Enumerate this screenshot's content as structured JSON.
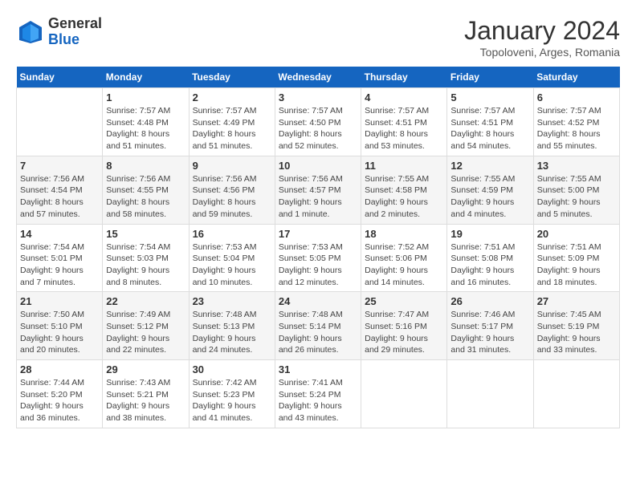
{
  "header": {
    "logo_general": "General",
    "logo_blue": "Blue",
    "month_title": "January 2024",
    "location": "Topoloveni, Arges, Romania"
  },
  "weekdays": [
    "Sunday",
    "Monday",
    "Tuesday",
    "Wednesday",
    "Thursday",
    "Friday",
    "Saturday"
  ],
  "weeks": [
    [
      {
        "day": "",
        "info": ""
      },
      {
        "day": "1",
        "info": "Sunrise: 7:57 AM\nSunset: 4:48 PM\nDaylight: 8 hours\nand 51 minutes."
      },
      {
        "day": "2",
        "info": "Sunrise: 7:57 AM\nSunset: 4:49 PM\nDaylight: 8 hours\nand 51 minutes."
      },
      {
        "day": "3",
        "info": "Sunrise: 7:57 AM\nSunset: 4:50 PM\nDaylight: 8 hours\nand 52 minutes."
      },
      {
        "day": "4",
        "info": "Sunrise: 7:57 AM\nSunset: 4:51 PM\nDaylight: 8 hours\nand 53 minutes."
      },
      {
        "day": "5",
        "info": "Sunrise: 7:57 AM\nSunset: 4:51 PM\nDaylight: 8 hours\nand 54 minutes."
      },
      {
        "day": "6",
        "info": "Sunrise: 7:57 AM\nSunset: 4:52 PM\nDaylight: 8 hours\nand 55 minutes."
      }
    ],
    [
      {
        "day": "7",
        "info": "Sunrise: 7:56 AM\nSunset: 4:54 PM\nDaylight: 8 hours\nand 57 minutes."
      },
      {
        "day": "8",
        "info": "Sunrise: 7:56 AM\nSunset: 4:55 PM\nDaylight: 8 hours\nand 58 minutes."
      },
      {
        "day": "9",
        "info": "Sunrise: 7:56 AM\nSunset: 4:56 PM\nDaylight: 8 hours\nand 59 minutes."
      },
      {
        "day": "10",
        "info": "Sunrise: 7:56 AM\nSunset: 4:57 PM\nDaylight: 9 hours\nand 1 minute."
      },
      {
        "day": "11",
        "info": "Sunrise: 7:55 AM\nSunset: 4:58 PM\nDaylight: 9 hours\nand 2 minutes."
      },
      {
        "day": "12",
        "info": "Sunrise: 7:55 AM\nSunset: 4:59 PM\nDaylight: 9 hours\nand 4 minutes."
      },
      {
        "day": "13",
        "info": "Sunrise: 7:55 AM\nSunset: 5:00 PM\nDaylight: 9 hours\nand 5 minutes."
      }
    ],
    [
      {
        "day": "14",
        "info": "Sunrise: 7:54 AM\nSunset: 5:01 PM\nDaylight: 9 hours\nand 7 minutes."
      },
      {
        "day": "15",
        "info": "Sunrise: 7:54 AM\nSunset: 5:03 PM\nDaylight: 9 hours\nand 8 minutes."
      },
      {
        "day": "16",
        "info": "Sunrise: 7:53 AM\nSunset: 5:04 PM\nDaylight: 9 hours\nand 10 minutes."
      },
      {
        "day": "17",
        "info": "Sunrise: 7:53 AM\nSunset: 5:05 PM\nDaylight: 9 hours\nand 12 minutes."
      },
      {
        "day": "18",
        "info": "Sunrise: 7:52 AM\nSunset: 5:06 PM\nDaylight: 9 hours\nand 14 minutes."
      },
      {
        "day": "19",
        "info": "Sunrise: 7:51 AM\nSunset: 5:08 PM\nDaylight: 9 hours\nand 16 minutes."
      },
      {
        "day": "20",
        "info": "Sunrise: 7:51 AM\nSunset: 5:09 PM\nDaylight: 9 hours\nand 18 minutes."
      }
    ],
    [
      {
        "day": "21",
        "info": "Sunrise: 7:50 AM\nSunset: 5:10 PM\nDaylight: 9 hours\nand 20 minutes."
      },
      {
        "day": "22",
        "info": "Sunrise: 7:49 AM\nSunset: 5:12 PM\nDaylight: 9 hours\nand 22 minutes."
      },
      {
        "day": "23",
        "info": "Sunrise: 7:48 AM\nSunset: 5:13 PM\nDaylight: 9 hours\nand 24 minutes."
      },
      {
        "day": "24",
        "info": "Sunrise: 7:48 AM\nSunset: 5:14 PM\nDaylight: 9 hours\nand 26 minutes."
      },
      {
        "day": "25",
        "info": "Sunrise: 7:47 AM\nSunset: 5:16 PM\nDaylight: 9 hours\nand 29 minutes."
      },
      {
        "day": "26",
        "info": "Sunrise: 7:46 AM\nSunset: 5:17 PM\nDaylight: 9 hours\nand 31 minutes."
      },
      {
        "day": "27",
        "info": "Sunrise: 7:45 AM\nSunset: 5:19 PM\nDaylight: 9 hours\nand 33 minutes."
      }
    ],
    [
      {
        "day": "28",
        "info": "Sunrise: 7:44 AM\nSunset: 5:20 PM\nDaylight: 9 hours\nand 36 minutes."
      },
      {
        "day": "29",
        "info": "Sunrise: 7:43 AM\nSunset: 5:21 PM\nDaylight: 9 hours\nand 38 minutes."
      },
      {
        "day": "30",
        "info": "Sunrise: 7:42 AM\nSunset: 5:23 PM\nDaylight: 9 hours\nand 41 minutes."
      },
      {
        "day": "31",
        "info": "Sunrise: 7:41 AM\nSunset: 5:24 PM\nDaylight: 9 hours\nand 43 minutes."
      },
      {
        "day": "",
        "info": ""
      },
      {
        "day": "",
        "info": ""
      },
      {
        "day": "",
        "info": ""
      }
    ]
  ]
}
